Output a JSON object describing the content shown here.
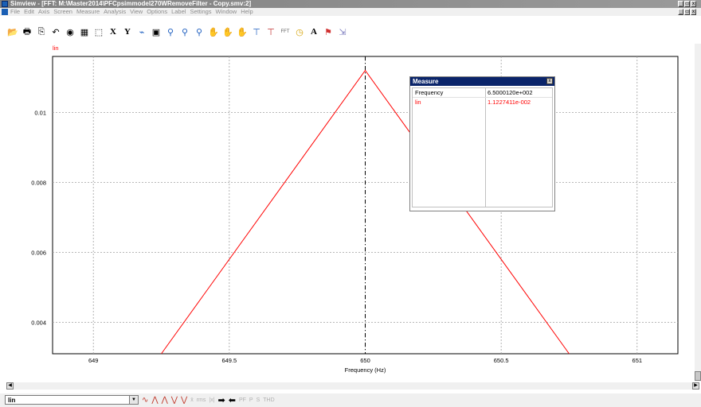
{
  "window": {
    "title": "Simview - [FFT: M:\\Master2014\\PFCpsimmodel270WRemoveFilter - Copy.smv:2]"
  },
  "menu": [
    "File",
    "Edit",
    "Axis",
    "Screen",
    "Measure",
    "Analysis",
    "View",
    "Options",
    "Label",
    "Settings",
    "Window",
    "Help"
  ],
  "toolbar": {
    "icons": [
      "open-icon",
      "print-icon",
      "copy-icon",
      "undo-icon",
      "data-icon",
      "graph-icon",
      "pointer-icon",
      "x-axis-button",
      "y-axis-button",
      "chart-icon",
      "display-icon",
      "zoom-icon",
      "zoom-in-icon",
      "zoom-out-icon",
      "pan-icon",
      "pan-x-icon",
      "pan-y-icon",
      "measure-icon",
      "measure-cursor-icon",
      "fft-button",
      "timer-icon",
      "text-button",
      "marker-icon",
      "export-icon"
    ],
    "x_label": "X",
    "y_label": "Y",
    "fft_label": "FFT",
    "a_label": "A"
  },
  "chart_data": {
    "type": "line",
    "series": [
      {
        "name": "lin",
        "color": "#ff0000",
        "x": [
          649.25,
          650.0,
          650.75
        ],
        "y": [
          0.0031,
          0.0112,
          0.0031
        ]
      }
    ],
    "cursor_x": 650,
    "xlabel": "Frequency (Hz)",
    "ylabel": "",
    "xlim": [
      648.85,
      651.15
    ],
    "ylim": [
      0.0031,
      0.0116
    ],
    "xticks": [
      649,
      649.5,
      650,
      650.5,
      651
    ],
    "xtick_labels": [
      "649",
      "649.5",
      "650",
      "650.5",
      "651"
    ],
    "yticks": [
      0.004,
      0.006,
      0.008,
      0.01
    ],
    "ytick_labels": [
      "0.004",
      "0.006",
      "0.008",
      "0.01"
    ],
    "grid": true,
    "legend": "top-left"
  },
  "measure": {
    "title": "Measure",
    "rows": [
      {
        "label": "Frequency",
        "value": "6.5000120e+002",
        "color": "#000000"
      },
      {
        "label": "lin",
        "value": "1.1227411e-002",
        "color": "#ff0000"
      }
    ]
  },
  "bottom": {
    "selected_variable": "lin",
    "text_buttons": [
      "PF",
      "P",
      "S",
      "THD"
    ]
  }
}
